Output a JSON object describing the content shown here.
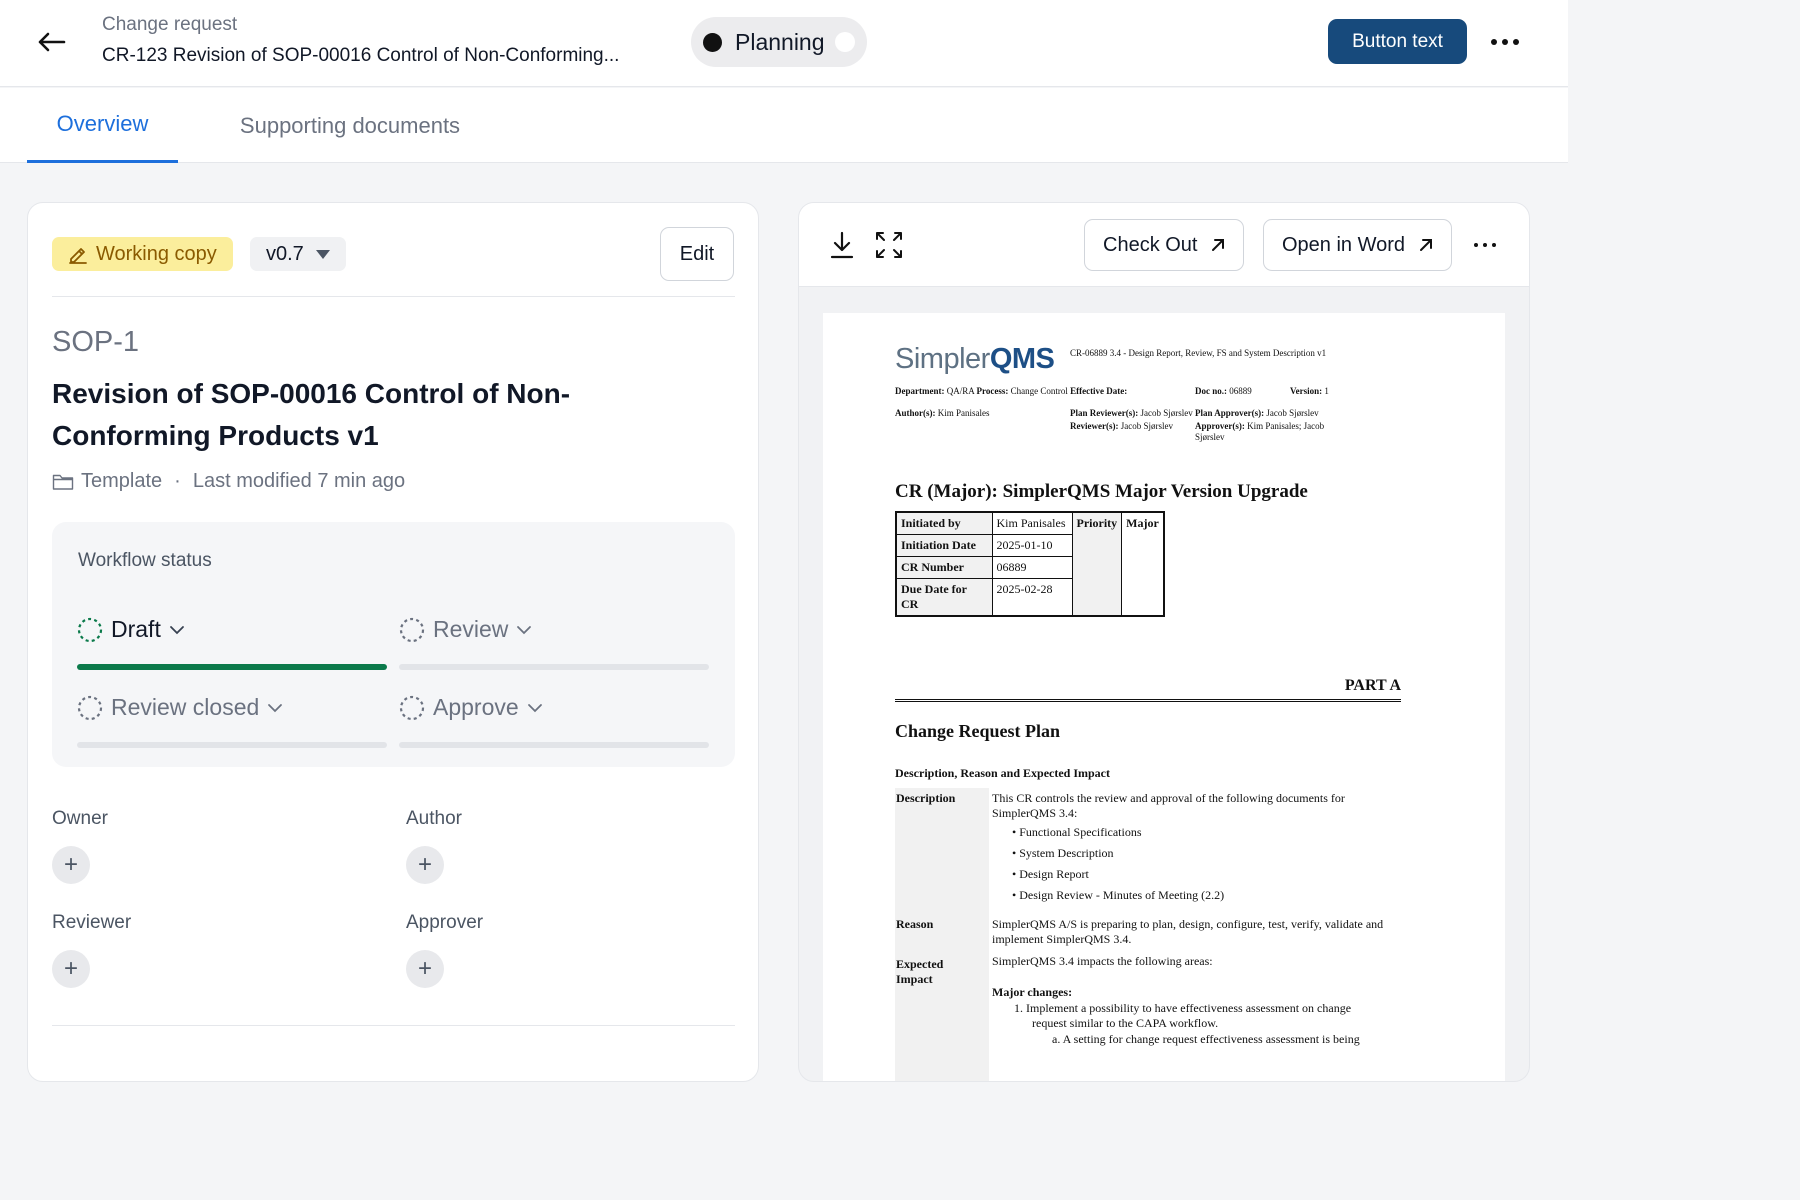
{
  "header": {
    "subtitle": "Change request",
    "title": "CR-123  Revision of SOP-00016 Control of Non-Conforming...",
    "status": "Planning",
    "primary_button": "Button text"
  },
  "tabs": [
    {
      "label": "Overview",
      "active": true
    },
    {
      "label": "Supporting documents",
      "active": false
    }
  ],
  "left": {
    "working_copy": "Working copy",
    "version": "v0.7",
    "edit": "Edit",
    "doc_code": "SOP-1",
    "doc_title": "Revision of SOP-00016 Control of Non-Conforming Products v1",
    "meta_type": "Template",
    "meta_dot": "·",
    "meta_modified": "Last modified 7 min ago",
    "workflow": {
      "label": "Workflow status",
      "steps": [
        {
          "label": "Draft",
          "complete": true
        },
        {
          "label": "Review",
          "complete": false
        },
        {
          "label": "Review closed",
          "complete": false
        },
        {
          "label": "Approve",
          "complete": false
        }
      ]
    },
    "roles": {
      "owner": "Owner",
      "author": "Author",
      "reviewer": "Reviewer",
      "approver": "Approver",
      "add_symbol": "+"
    }
  },
  "right": {
    "check_out": "Check Out",
    "open_in_word": "Open in Word",
    "document": {
      "logo_prefix": "Simpler",
      "logo_brand": "QMS",
      "header_ref": "CR-06889 3.4 - Design Report, Review, FS and System Description v1",
      "department_label": "Department:",
      "department": "QA/RA",
      "process_label": "Process:",
      "process": "Change Control",
      "effective_label": "Effective Date:",
      "doc_no_label": "Doc no.:",
      "doc_no": "06889",
      "version_label": "Version:",
      "version": "1",
      "authors_label": "Author(s):",
      "authors": "Kim Panisales",
      "plan_reviewers_label": "Plan Reviewer(s):",
      "plan_reviewers": "Jacob Sjørslev",
      "plan_approvers_label": "Plan Approver(s):",
      "plan_approvers": "Jacob Sjørslev",
      "reviewers_label": "Reviewer(s):",
      "reviewers": "Jacob Sjørslev",
      "approvers_label": "Approver(s):",
      "approvers_line1": "Kim Panisales; Jacob",
      "approvers_line2": "Sjørslev",
      "cr_heading": "CR (Major): SimplerQMS Major Version Upgrade",
      "table": {
        "initiated_by_label": "Initiated by",
        "initiated_by": "Kim Panisales",
        "priority_label": "Priority",
        "priority": "Major",
        "initiation_date_label": "Initiation Date",
        "initiation_date": "2025-01-10",
        "cr_number_label": "CR Number",
        "cr_number": "06889",
        "due_date_label_1": "Due Date for",
        "due_date_label_2": "CR",
        "due_date": "2025-02-28"
      },
      "part": "PART A",
      "section": "Change Request Plan",
      "subsection": "Description, Reason and Expected Impact",
      "description_label": "Description",
      "description_text": "This CR controls the review and approval of the following documents for SimplerQMS 3.4:",
      "description_items": [
        "Functional Specifications",
        "System Description",
        "Design Report",
        "Design Review - Minutes of Meeting (2.2)"
      ],
      "reason_label": "Reason",
      "reason_text": "SimplerQMS A/S is preparing to plan, design, configure, test, verify, validate and implement SimplerQMS 3.4.",
      "impact_label_1": "Expected",
      "impact_label_2": "Impact",
      "impact_text": "SimplerQMS 3.4 impacts the following areas:",
      "major_changes": "Major changes:",
      "change_1a": "1. Implement a possibility to have effectiveness assessment on change",
      "change_1b": "request similar to the CAPA workflow.",
      "change_1c": "a. A setting for change request effectiveness assessment is being"
    }
  },
  "colors": {
    "accent": "#1d6fdc",
    "primary_button": "#174a7c",
    "progress_complete": "#0b7a4b",
    "working_copy_bg": "#fbee9c"
  },
  "icons": [
    "back-arrow-icon",
    "more-horizontal-icon",
    "pencil-icon",
    "caret-down-icon",
    "folder-icon",
    "status-pending-icon",
    "chevron-down-icon",
    "plus-icon",
    "download-icon",
    "expand-icon",
    "external-link-icon"
  ]
}
